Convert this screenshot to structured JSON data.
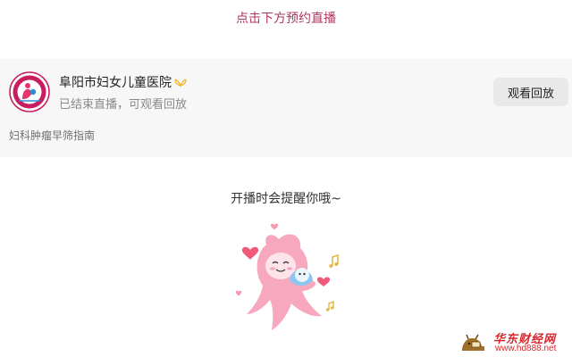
{
  "header": {
    "booking_prompt": "点击下方预约直播"
  },
  "live_card": {
    "avatar_icon": "hospital-logo-icon",
    "hospital_name": "阜阳市妇女儿童医院",
    "verified_icon": "verified-badge-icon",
    "status_text": "已结束直播，可观看回放",
    "replay_button_label": "观看回放",
    "topic": "妇科肿瘤早筛指南"
  },
  "reminder": {
    "text": "开播时会提醒你哦~",
    "illustration_icon": "mascot-hugging-baby-icon"
  },
  "watermark": {
    "brand": "华东财经网",
    "url": "www.hd888.net",
    "logo_icon": "ox-reading-icon"
  },
  "colors": {
    "accent": "#b0365e",
    "card_background": "#f7f7f7",
    "button_background": "#e9e9e9",
    "watermark_red": "#d7262c",
    "mascot_pink": "#f7a8bf"
  }
}
